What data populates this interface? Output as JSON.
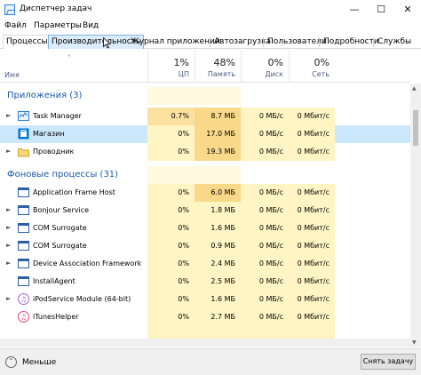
{
  "window": {
    "title": "Диспетчер задач",
    "minimize_icon": "minimize-icon",
    "maximize_icon": "maximize-icon",
    "close_icon": "close-icon"
  },
  "menu": [
    "Файл",
    "Параметры",
    "Вид"
  ],
  "tabs": [
    "Процессы",
    "Производительность",
    "Журнал приложений",
    "Автозагрузка",
    "Пользователи",
    "Подробности",
    "Службы"
  ],
  "active_tab": "Процессы",
  "hover_tab": "Производительность",
  "columns": {
    "name": "Имя",
    "cpu": {
      "percent": "1%",
      "label": "ЦП"
    },
    "memory": {
      "percent": "48%",
      "label": "Память"
    },
    "disk": {
      "percent": "0%",
      "label": "Диск"
    },
    "network": {
      "percent": "0%",
      "label": "Сеть"
    }
  },
  "groups": {
    "apps": "Приложения (3)",
    "background": "Фоновые процессы (31)"
  },
  "processes": [
    {
      "name": "Task Manager",
      "cpu": "0.7%",
      "memory": "8.7 МБ",
      "disk": "0 МБ/с",
      "network": "0 Мбит/с",
      "expandable": true,
      "icon": "task-manager-icon"
    },
    {
      "name": "Магазин",
      "cpu": "0%",
      "memory": "17.0 МБ",
      "disk": "0 МБ/с",
      "network": "0 Мбит/с",
      "expandable": false,
      "icon": "store-icon"
    },
    {
      "name": "Проводник",
      "cpu": "0%",
      "memory": "19.3 МБ",
      "disk": "0 МБ/с",
      "network": "0 Мбит/с",
      "expandable": true,
      "icon": "folder-icon"
    },
    {
      "name": "Application Frame Host",
      "cpu": "0%",
      "memory": "6.0 МБ",
      "disk": "0 МБ/с",
      "network": "0 Мбит/с",
      "expandable": false,
      "icon": "app-window-icon"
    },
    {
      "name": "Bonjour Service",
      "cpu": "0%",
      "memory": "1.8 МБ",
      "disk": "0 МБ/с",
      "network": "0 Мбит/с",
      "expandable": true,
      "icon": "app-window-icon"
    },
    {
      "name": "COM Surrogate",
      "cpu": "0%",
      "memory": "1.6 МБ",
      "disk": "0 МБ/с",
      "network": "0 Мбит/с",
      "expandable": true,
      "icon": "app-window-icon"
    },
    {
      "name": "COM Surrogate",
      "cpu": "0%",
      "memory": "0.9 МБ",
      "disk": "0 МБ/с",
      "network": "0 Мбит/с",
      "expandable": true,
      "icon": "app-window-icon"
    },
    {
      "name": "Device Association Framework ...",
      "cpu": "0%",
      "memory": "2.4 МБ",
      "disk": "0 МБ/с",
      "network": "0 Мбит/с",
      "expandable": true,
      "icon": "app-window-icon"
    },
    {
      "name": "InstallAgent",
      "cpu": "0%",
      "memory": "2.5 МБ",
      "disk": "0 МБ/с",
      "network": "0 Мбит/с",
      "expandable": false,
      "icon": "app-window-icon"
    },
    {
      "name": "iPodService Module (64-bit)",
      "cpu": "0%",
      "memory": "1.6 МБ",
      "disk": "0 МБ/с",
      "network": "0 Мбит/с",
      "expandable": true,
      "icon": "ipod-icon"
    },
    {
      "name": "iTunesHelper",
      "cpu": "0%",
      "memory": "2.7 МБ",
      "disk": "0 МБ/с",
      "network": "0 Мбит/с",
      "expandable": false,
      "icon": "itunes-icon"
    }
  ],
  "footer": {
    "fewer_details": "Меньше",
    "end_task": "Снять задачу"
  },
  "colors": {
    "selected_row": "#cce8ff",
    "heat_light": "#fff4c4",
    "heat_medium": "#fbe1a0",
    "group_text": "#1a5aa6"
  }
}
